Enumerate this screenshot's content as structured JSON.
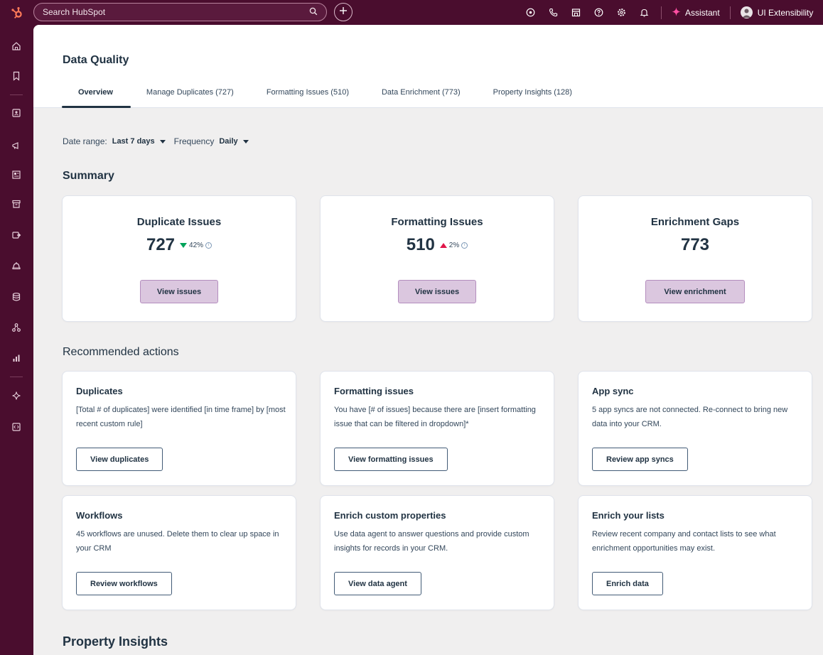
{
  "topbar": {
    "search_placeholder": "Search HubSpot",
    "assistant_label": "Assistant",
    "account_name": "UI Extensibility"
  },
  "header": {
    "title": "Data Quality",
    "tabs": [
      {
        "label": "Overview",
        "active": true
      },
      {
        "label": "Manage Duplicates (727)"
      },
      {
        "label": "Formatting Issues (510)"
      },
      {
        "label": "Data Enrichment (773)"
      },
      {
        "label": "Property Insights (128)"
      }
    ]
  },
  "filters": {
    "date_range_label": "Date range:",
    "date_range_value": "Last 7 days",
    "frequency_label": "Frequency",
    "frequency_value": "Daily"
  },
  "summary": {
    "title": "Summary",
    "cards": [
      {
        "title": "Duplicate Issues",
        "value": "727",
        "trend": "42%",
        "direction": "down",
        "button": "View issues"
      },
      {
        "title": "Formatting Issues",
        "value": "510",
        "trend": "2%",
        "direction": "up",
        "button": "View issues"
      },
      {
        "title": "Enrichment Gaps",
        "value": "773",
        "button": "View enrichment"
      }
    ]
  },
  "recommended": {
    "title": "Recommended actions",
    "cards": [
      {
        "title": "Duplicates",
        "desc": "[Total # of duplicates] were identified [in time frame] by [most recent custom rule]",
        "button": "View duplicates"
      },
      {
        "title": "Formatting issues",
        "desc": "You have [# of issues] because there are [insert formatting issue that can be filtered in dropdown]*",
        "button": "View formatting issues"
      },
      {
        "title": "App sync",
        "desc": "5 app syncs are not connected. Re-connect to bring new data into your CRM.",
        "button": "Review app syncs"
      },
      {
        "title": "Workflows",
        "desc": "45 workflows are unused. Delete them to clear up space in your CRM",
        "button": "Review workflows"
      },
      {
        "title": "Enrich custom properties",
        "desc": "Use data agent to answer questions and provide custom insights for records in your CRM.",
        "button": "View data agent"
      },
      {
        "title": "Enrich your lists",
        "desc": "Review recent company and contact lists to see what enrichment opportunities may exist.",
        "button": "Enrich data"
      }
    ]
  },
  "property_insights": {
    "title": "Property Insights"
  },
  "colors": {
    "brand_dark": "#4a0d2e",
    "accent_orange": "#ff7a59",
    "primary_button": "#dbc7df",
    "trend_down": "#00a35a",
    "trend_up": "#e0174a"
  },
  "icons": {
    "top": [
      "help-circle-icon",
      "phone-icon",
      "marketplace-icon",
      "question-icon",
      "settings-icon",
      "bell-icon"
    ],
    "nav": [
      "home-icon",
      "bookmark-icon",
      "contacts-icon",
      "marketing-icon",
      "content-icon",
      "commerce-icon",
      "automation-icon",
      "service-icon",
      "data-management-icon",
      "integrations-icon",
      "reporting-icon",
      "ai-agent-icon",
      "developer-icon"
    ]
  }
}
